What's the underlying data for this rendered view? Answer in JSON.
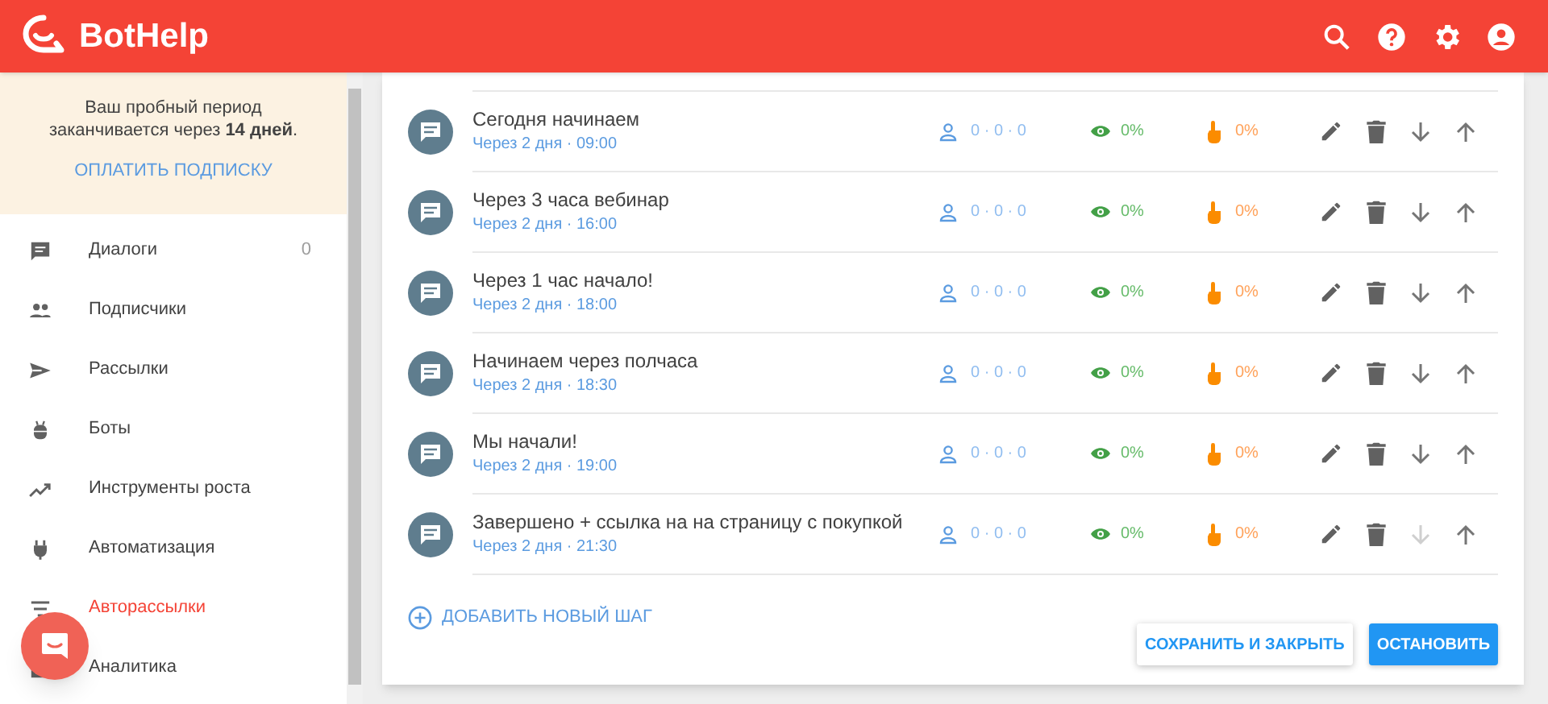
{
  "header": {
    "logo": "BotHelp"
  },
  "trial": {
    "text": "Ваш пробный период заканчивается через **14 дней**.",
    "link": "ОПЛАТИТЬ ПОДПИСКУ"
  },
  "nav": [
    {
      "kind": "chat",
      "label": "Диалоги",
      "count": "0",
      "selected": false
    },
    {
      "kind": "people",
      "label": "Подписчики",
      "selected": false
    },
    {
      "kind": "send",
      "label": "Рассылки",
      "selected": false
    },
    {
      "kind": "bot",
      "label": "Боты",
      "selected": false
    },
    {
      "kind": "trend",
      "label": "Инструменты роста",
      "selected": false
    },
    {
      "kind": "plug",
      "label": "Автоматизация",
      "selected": false
    },
    {
      "kind": "filter",
      "label": "Авторассылки",
      "selected": true
    },
    {
      "kind": "chart",
      "label": "Аналитика",
      "selected": false
    }
  ],
  "steps": [
    {
      "title": "Сегодня начинаем",
      "schedule": "Через 2 дня · 09:00",
      "stats": "0 · 0 · 0",
      "views": "0%",
      "clicks": "0%",
      "move_down_disabled": false
    },
    {
      "title": "Через 3 часа вебинар",
      "schedule": "Через 2 дня · 16:00",
      "stats": "0 · 0 · 0",
      "views": "0%",
      "clicks": "0%",
      "move_down_disabled": false
    },
    {
      "title": "Через 1 час начало!",
      "schedule": "Через 2 дня · 18:00",
      "stats": "0 · 0 · 0",
      "views": "0%",
      "clicks": "0%",
      "move_down_disabled": false
    },
    {
      "title": "Начинаем через полчаса",
      "schedule": "Через 2 дня · 18:30",
      "stats": "0 · 0 · 0",
      "views": "0%",
      "clicks": "0%",
      "move_down_disabled": false
    },
    {
      "title": "Мы начали!",
      "schedule": "Через 2 дня · 19:00",
      "stats": "0 · 0 · 0",
      "views": "0%",
      "clicks": "0%",
      "move_down_disabled": false
    },
    {
      "title": "Завершено + ссылка на на страницу с покупкой",
      "schedule": "Через 2 дня · 21:30",
      "stats": "0 · 0 · 0",
      "views": "0%",
      "clicks": "0%",
      "move_down_disabled": true
    }
  ],
  "add_step": "ДОБАВИТЬ НОВЫЙ ШАГ",
  "buttons": [
    {
      "kind": "outline",
      "label": "СОХРАНИТЬ И ЗАКРЫТЬ"
    },
    {
      "kind": "primary",
      "label": "ОСТАНОВИТЬ"
    }
  ]
}
